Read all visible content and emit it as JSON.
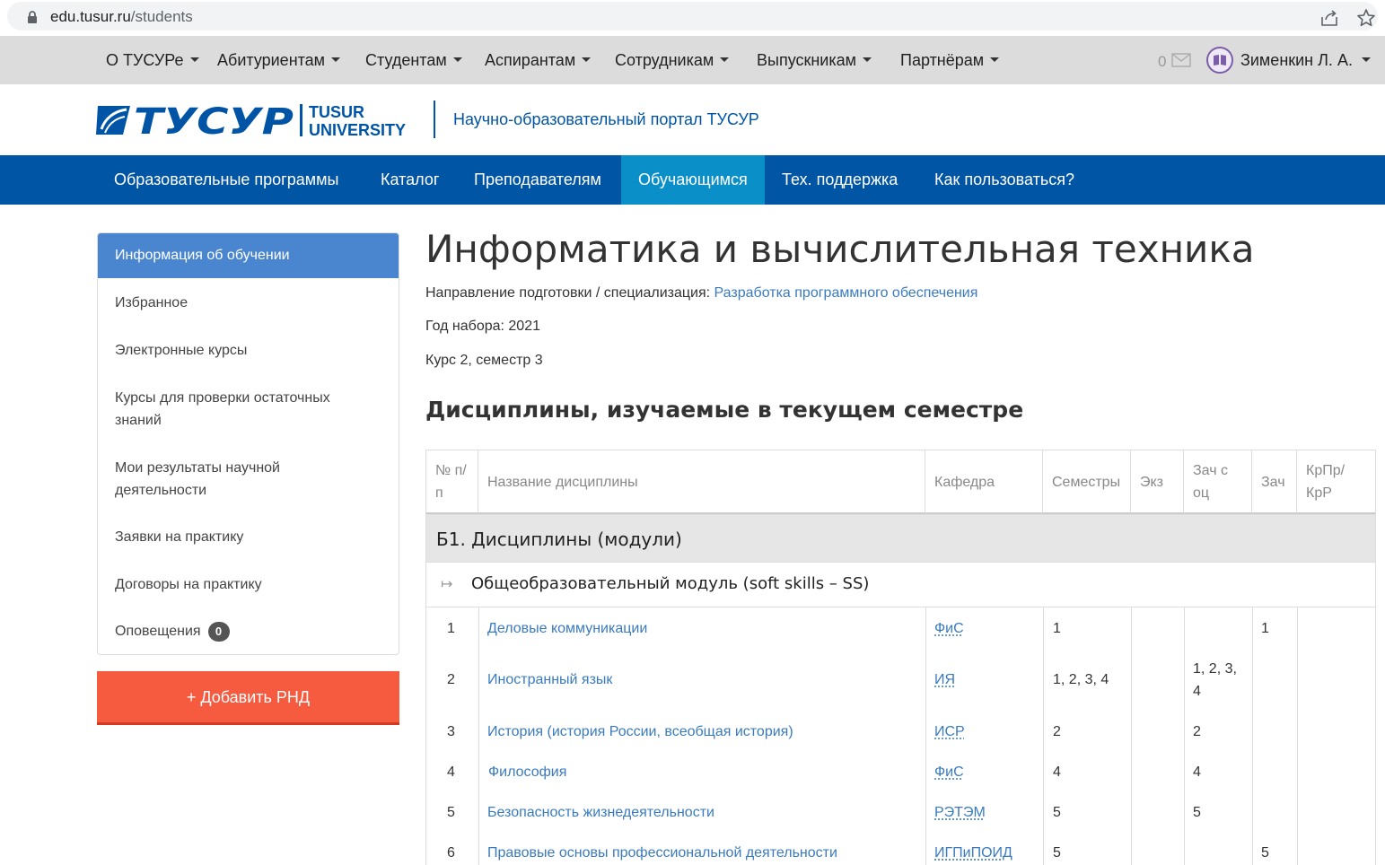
{
  "browser": {
    "url_host": "edu.tusur.ru",
    "url_path": "/students"
  },
  "top_nav": {
    "items": [
      "О ТУСУРе",
      "Абитуриентам",
      "Студентам",
      "Аспирантам",
      "Сотрудникам",
      "Выпускникам",
      "Партнёрам"
    ],
    "mail_count": "0",
    "user_name": "Зименкин Л. А."
  },
  "logo": {
    "brand": "ТУСУР",
    "line1": "TUSUR",
    "line2": "UNIVERSITY",
    "portal_title": "Научно-образовательный портал ТУСУР"
  },
  "main_nav": {
    "items": [
      "Образовательные программы",
      "Каталог",
      "Преподавателям",
      "Обучающимся",
      "Тех. поддержка",
      "Как пользоваться?"
    ],
    "active": "Обучающимся"
  },
  "sidebar": {
    "items": [
      "Информация об обучении",
      "Избранное",
      "Электронные курсы",
      "Курсы для проверки остаточных знаний",
      "Мои результаты научной деятельности",
      "Заявки на практику",
      "Договоры на практику",
      "Оповещения"
    ],
    "notifications_count": "0",
    "add_button": "+ Добавить РНД"
  },
  "main": {
    "title": "Информатика и вычислительная техника",
    "direction_label": "Направление подготовки / специализация:",
    "direction_value": "Разработка программного обеспечения",
    "year": "Год набора: 2021",
    "course": "Курс 2, семестр 3",
    "section_title": "Дисциплины, изучаемые в текущем семестре"
  },
  "table": {
    "headers": [
      "№ п/п",
      "Название дисциплины",
      "Кафедра",
      "Семестры",
      "Экз",
      "Зач с оц",
      "Зач",
      "КрПр/ КрР"
    ],
    "group": "Б1. Дисциплины (модули)",
    "module": "Общеобразовательный модуль (soft skills – SS)",
    "module_arrow": "↦",
    "rows": [
      {
        "num": "1",
        "name": "Деловые коммуникации",
        "dept": "ФиС",
        "semesters": "1",
        "exam": "",
        "credit_grade": "",
        "credit": "1",
        "coursework": ""
      },
      {
        "num": "2",
        "name": "Иностранный язык",
        "dept": "ИЯ",
        "semesters": "1, 2, 3, 4",
        "exam": "",
        "credit_grade": "1, 2, 3, 4",
        "credit": "",
        "coursework": ""
      },
      {
        "num": "3",
        "name": "История (история России, всеобщая история)",
        "dept": "ИСР",
        "semesters": "2",
        "exam": "",
        "credit_grade": "2",
        "credit": "",
        "coursework": ""
      },
      {
        "num": "4",
        "name": "Философия",
        "dept": "ФиС",
        "semesters": "4",
        "exam": "",
        "credit_grade": "4",
        "credit": "",
        "coursework": ""
      },
      {
        "num": "5",
        "name": "Безопасность жизнедеятельности",
        "dept": "РЭТЭМ",
        "semesters": "5",
        "exam": "",
        "credit_grade": "5",
        "credit": "",
        "coursework": ""
      },
      {
        "num": "6",
        "name": "Правовые основы профессиональной деятельности",
        "dept": "ИГПиПОИД",
        "semesters": "5",
        "exam": "",
        "credit_grade": "",
        "credit": "5",
        "coursework": ""
      }
    ]
  },
  "colors": {
    "main_nav_bg": "#0055a5",
    "main_nav_active": "#0b8fc9",
    "sidebar_active": "#4a86cf",
    "add_button": "#f65a3f",
    "link": "#3a7bbf"
  }
}
